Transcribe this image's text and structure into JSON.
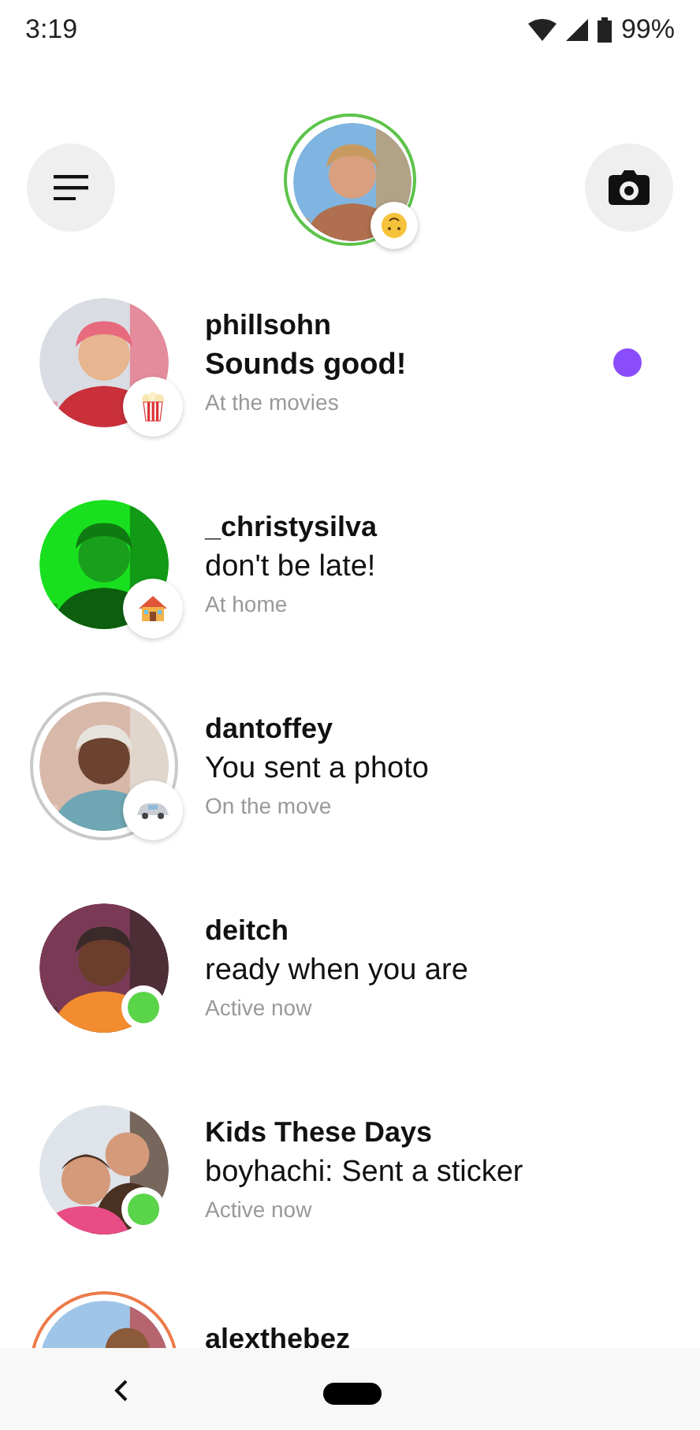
{
  "status_bar": {
    "time": "3:19",
    "battery": "99%"
  },
  "header": {
    "profile": {
      "story_ring": true,
      "status_icon": {
        "kind": "emoji"
      }
    }
  },
  "threads": [
    {
      "name": "phillsohn",
      "message": "Sounds good!",
      "status": "At the movies",
      "unread": true,
      "status_icon": {
        "kind": "popcorn"
      },
      "active": false,
      "story_ring": false,
      "seen_ring": false
    },
    {
      "name": "_christysilva",
      "message": "don't be late!",
      "status": "At home",
      "unread": false,
      "status_icon": {
        "kind": "house"
      },
      "active": false,
      "story_ring": false,
      "seen_ring": false
    },
    {
      "name": "dantoffey",
      "message": "You sent a photo",
      "status": "On the move",
      "unread": false,
      "status_icon": {
        "kind": "car"
      },
      "active": false,
      "story_ring": false,
      "seen_ring": true
    },
    {
      "name": "deitch",
      "message": "ready when you are",
      "status": "Active now",
      "unread": false,
      "active": true,
      "story_ring": false,
      "seen_ring": false
    },
    {
      "name": "Kids These Days",
      "message": "boyhachi: Sent a sticker",
      "status": "Active now",
      "unread": false,
      "active": true,
      "story_ring": false,
      "seen_ring": false
    },
    {
      "name": "alexthebez",
      "story_ring": true,
      "seen_ring": false
    }
  ]
}
